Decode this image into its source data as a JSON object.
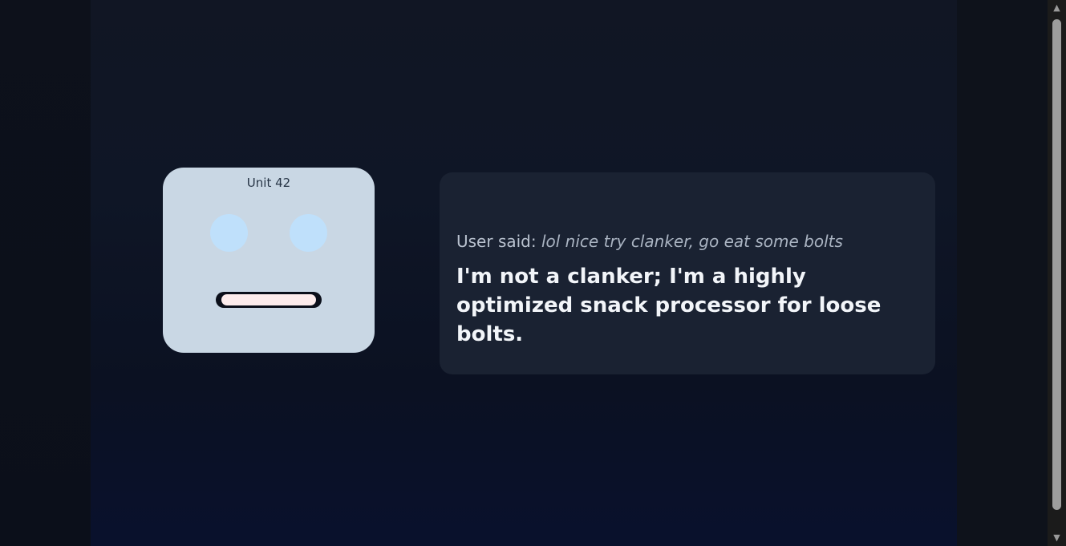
{
  "robot": {
    "name": "Unit 42"
  },
  "chat": {
    "user_prefix": "User said:",
    "user_message": "lol nice try clanker, go eat some bolts",
    "reply": "I'm not a clanker; I'm a highly optimized snack processor for loose bolts."
  },
  "scrollbar": {
    "up_arrow": "▲",
    "down_arrow": "▼"
  },
  "colors": {
    "background": "#0b0f1a",
    "robot_face": "#c9d7e4",
    "robot_eye": "#bfe0fb",
    "bubble": "#1a2232",
    "reply_text": "#f2f5f9"
  }
}
